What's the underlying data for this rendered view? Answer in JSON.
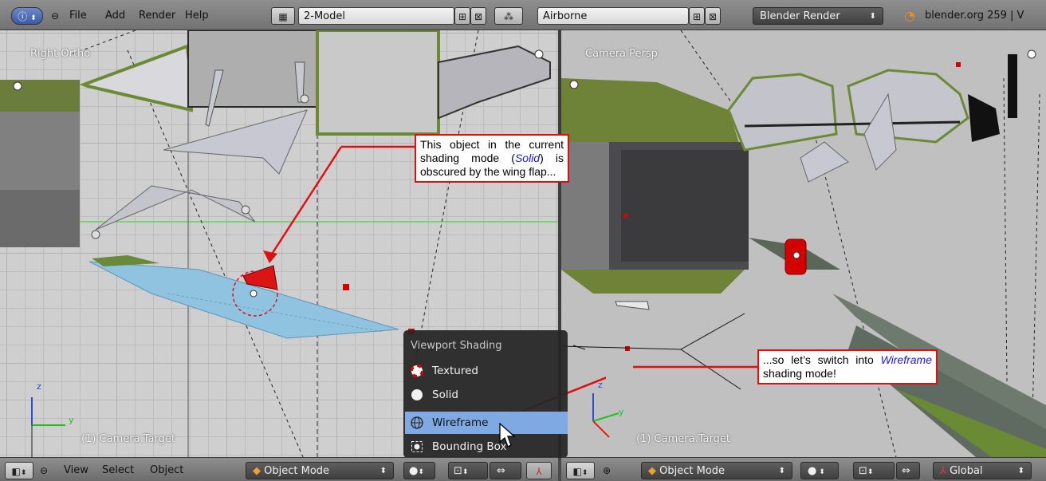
{
  "header": {
    "menus": [
      "File",
      "Add",
      "Render",
      "Help"
    ],
    "screen_layout": "2-Model",
    "scene": "Airborne",
    "render_engine": "Blender Render",
    "status": "blender.org 259 | V"
  },
  "viewports": {
    "left": {
      "title": "Right Ortho",
      "object_name": "(1) Camera.Target",
      "axis_z": "z",
      "axis_y": "y"
    },
    "right": {
      "title": "Camera Persp",
      "object_name": "(1) Camera.Target",
      "axis_z": "z",
      "axis_y": "y"
    }
  },
  "callouts": {
    "top": {
      "before": "This object in the current shading mode (",
      "em": "Solid",
      "after": ") is obscured by the wing flap..."
    },
    "bottom": {
      "before": "...so let’s switch into ",
      "em": "Wireframe",
      "after": " shading mode!"
    }
  },
  "shading_menu": {
    "title": "Viewport Shading",
    "items": [
      {
        "label": "Textured",
        "icon": "textured-icon"
      },
      {
        "label": "Solid",
        "icon": "solid-icon"
      },
      {
        "label": "Wireframe",
        "icon": "wireframe-icon",
        "highlighted": true
      },
      {
        "label": "Bounding Box",
        "icon": "bounding-box-icon"
      }
    ]
  },
  "footer_left": {
    "menus": [
      "View",
      "Select",
      "Object"
    ],
    "mode": "Object Mode"
  },
  "footer_right": {
    "mode": "Object Mode",
    "orientation": "Global"
  },
  "colors": {
    "callout_border": "#e01010",
    "menu_highlight": "#7ea9e2",
    "emphasis_text": "#1a1ad8"
  }
}
